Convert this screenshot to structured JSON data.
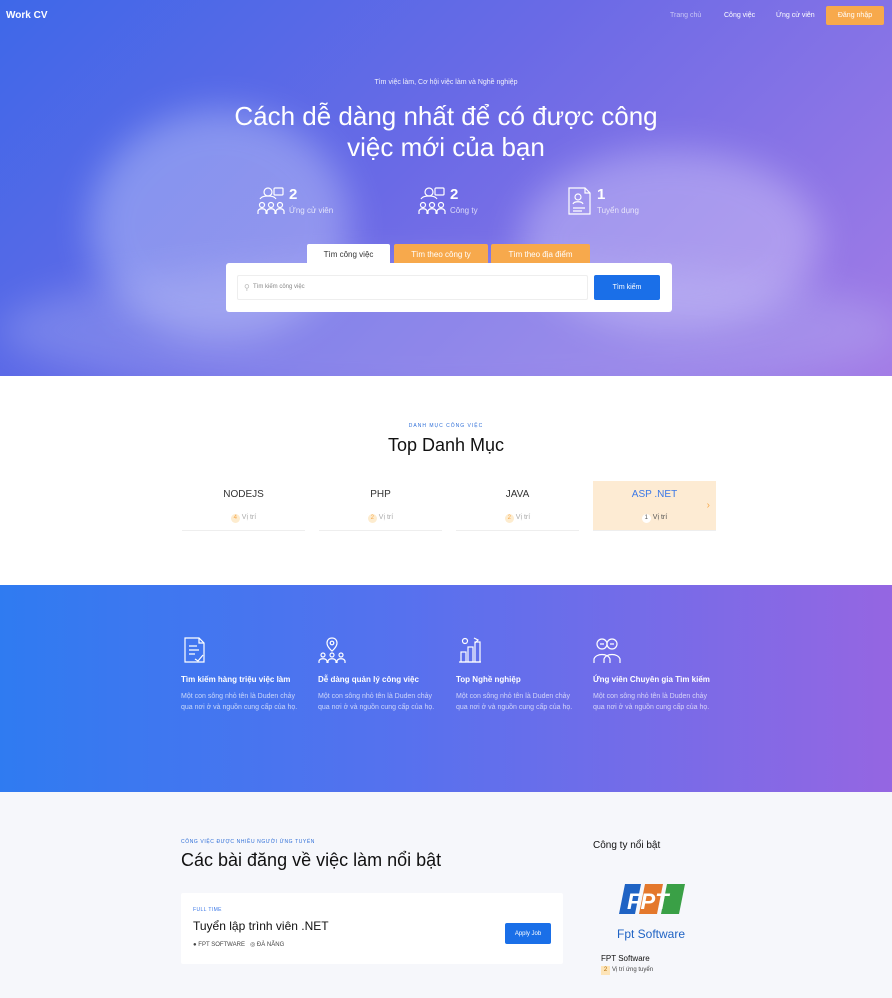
{
  "header": {
    "brand": "Work CV",
    "nav": [
      "Trang chủ",
      "Công việc",
      "Ứng cử viên"
    ],
    "login": "Đăng nhập"
  },
  "hero": {
    "subtitle": "Tìm việc làm, Cơ hội việc làm và Nghề nghiệp",
    "title_line1": "Cách dễ dàng nhất để có được công",
    "title_line2": "việc mới của bạn",
    "stats": [
      {
        "icon": "candidates-icon",
        "value": "2",
        "label": "Ứng cử viên"
      },
      {
        "icon": "companies-icon",
        "value": "2",
        "label": "Công ty"
      },
      {
        "icon": "recruitment-icon",
        "value": "1",
        "label": "Tuyển dụng"
      }
    ],
    "tabs": [
      "Tìm công việc",
      "Tìm theo công ty",
      "Tìm theo địa điểm"
    ],
    "search_placeholder": "Tìm kiếm công việc",
    "search_button": "Tìm kiếm"
  },
  "categories": {
    "kicker": "DANH MỤC CÔNG VIỆC",
    "title": "Top Danh Mục",
    "unit": "Vị trí",
    "items": [
      {
        "name": "NODEJS",
        "count": "4"
      },
      {
        "name": "PHP",
        "count": "2"
      },
      {
        "name": "JAVA",
        "count": "2"
      },
      {
        "name": "ASP .NET",
        "count": "1"
      }
    ]
  },
  "features": [
    {
      "icon": "job-search-icon",
      "title": "Tìm kiếm hàng triệu việc làm",
      "desc": "Một con sông nhỏ tên là Duden chảy qua nơi ở và nguồn cung cấp của họ."
    },
    {
      "icon": "manage-jobs-icon",
      "title": "Dễ dàng quản lý công việc",
      "desc": "Một con sông nhỏ tên là Duden chảy qua nơi ở và nguồn cung cấp của họ."
    },
    {
      "icon": "career-icon",
      "title": "Top Nghề nghiệp",
      "desc": "Một con sông nhỏ tên là Duden chảy qua nơi ở và nguồn cung cấp của họ."
    },
    {
      "icon": "expert-icon",
      "title": "Ứng viên Chuyên gia Tìm kiếm",
      "desc": "Một con sông nhỏ tên là Duden chảy qua nơi ở và nguồn cung cấp của họ."
    }
  ],
  "jobs": {
    "kicker": "CÔNG VIỆC ĐƯỢC NHIỀU NGƯỜI ỨNG TUYỂN",
    "title": "Các bài đăng về việc làm nổi bật",
    "list": [
      {
        "type": "FULL TIME",
        "title": "Tuyển lập trình viên .NET",
        "company": "FPT SOFTWARE",
        "location": "ĐÀ NẴNG",
        "apply": "Apply Job"
      }
    ]
  },
  "featured_company": {
    "heading": "Công ty nổi bật",
    "logo_text": "FPT",
    "logo_caption": "Fpt Software",
    "name": "FPT Software",
    "count": "2",
    "count_label": "Vị trí ứng tuyển"
  },
  "colors": {
    "accent": "#f7a94c",
    "primary": "#1a6fe8"
  }
}
